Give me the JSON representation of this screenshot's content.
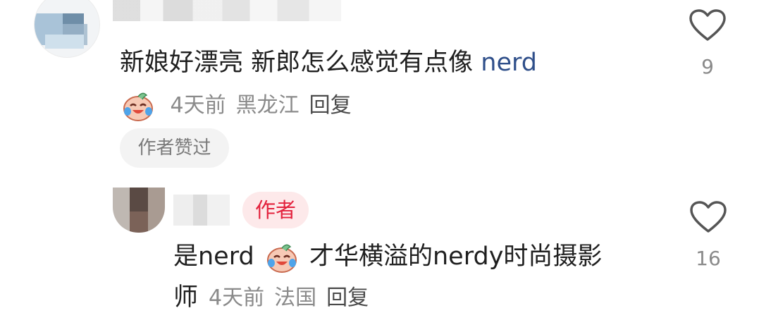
{
  "comment": {
    "text_before": "新娘好漂亮 新郎怎么感觉有点像 ",
    "highlight": "nerd",
    "meta_time": "4天前",
    "meta_location": "黑龙江",
    "meta_reply": "回复",
    "author_liked": "作者赞过",
    "like_count": "9"
  },
  "reply": {
    "author_badge": "作者",
    "text_prefix": "是nerd",
    "text_main": "才华横溢的nerdy时尚摄影",
    "text_wrap": "师",
    "meta_time": "4天前",
    "meta_location": "法国",
    "meta_reply": "回复",
    "like_count": "16"
  },
  "colors": {
    "link_blue": "#2f4f8a",
    "author_red": "#e3223d",
    "author_badge_bg": "#fde9ea",
    "meta_gray": "#8a8a8a"
  },
  "icons": {
    "emoji": "crying-laughing-face-icon",
    "like": "heart-outline-icon"
  }
}
